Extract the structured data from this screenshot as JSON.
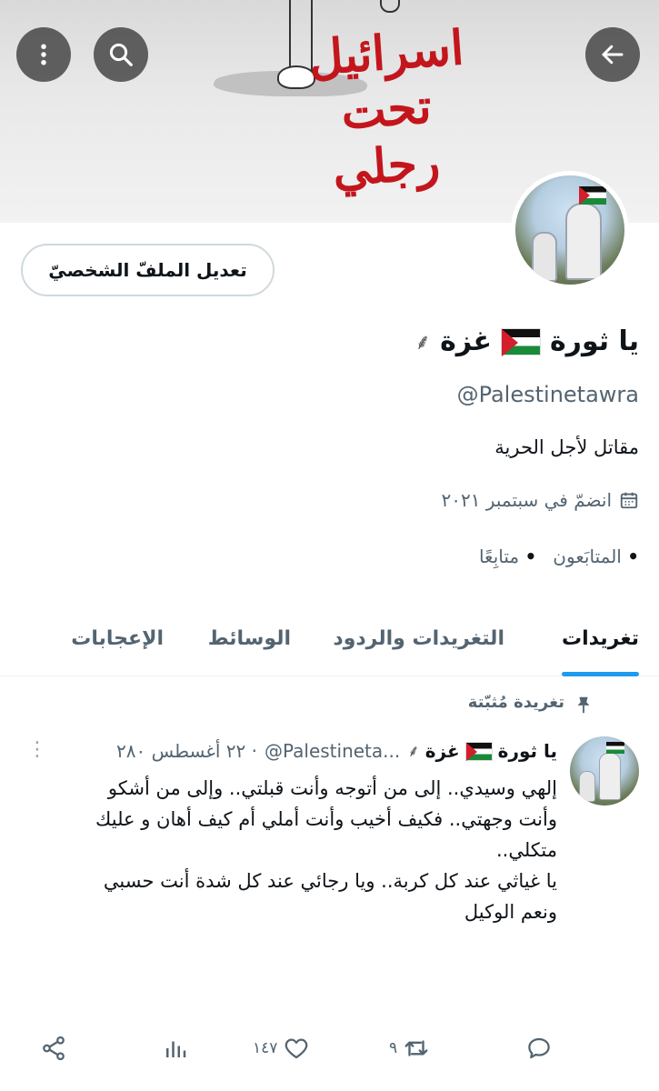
{
  "banner": {
    "text_lines": [
      "اسرائيل",
      "تحت",
      "رجلي"
    ]
  },
  "header": {
    "back_icon": "arrow-left-icon",
    "search_icon": "search-icon",
    "more_icon": "more-vertical-icon"
  },
  "profile": {
    "edit_button": "تعديل الملفّ الشخصيّ",
    "name_part1": "يا ثورة",
    "name_part2": "غزة",
    "map_glyph": "⸙",
    "handle": "@Palestinetawra",
    "bio": "مقاتل لأجل الحرية",
    "joined": "انضمّ في سبتمبر ٢٠٢١",
    "followers_label": "المتابَعون",
    "following_label": "متابِعًا"
  },
  "tabs": [
    {
      "label": "تغريدات",
      "active": true
    },
    {
      "label": "التغريدات والردود",
      "active": false
    },
    {
      "label": "الوسائط",
      "active": false
    },
    {
      "label": "الإعجابات",
      "active": false
    }
  ],
  "pinned_tweet": {
    "pinned_label": "تغريدة مُثبّتة",
    "name_part1": "يا ثورة",
    "name_part2": "غزة",
    "handle": "@Palestineta...",
    "date": "٢٢ أغسطس ٢٨٠",
    "body_lines": [
      "إلهي وسيدي.. إلى من أتوجه وأنت قبلتي.. وإلى من أشكو",
      "وأنت وجهتي.. فكيف أخيب وأنت أملي أم كيف أهان و عليك",
      "متكلي..",
      "يا غياثي عند كل كربة.. ويا رجائي عند كل شدة أنت حسبي",
      "ونعم الوكيل"
    ],
    "reply_count": "",
    "retweet_count": "٩",
    "like_count": "١٤٧",
    "views_count": ""
  },
  "colors": {
    "accent": "#1d9bf0",
    "text": "#0f1419",
    "muted": "#536471",
    "banner_red": "#c3161c"
  }
}
